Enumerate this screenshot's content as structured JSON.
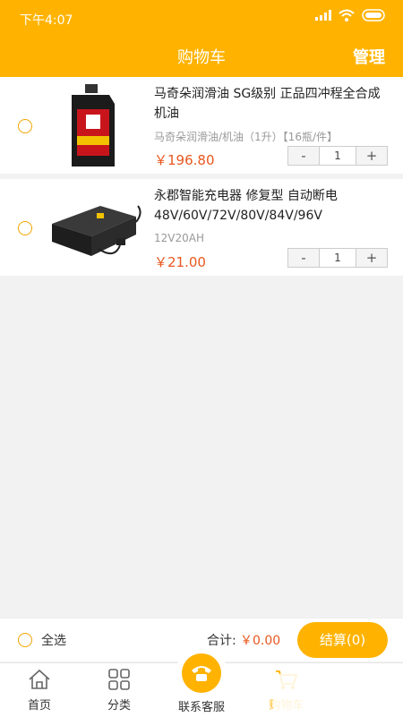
{
  "status": {
    "time": "下午4:07"
  },
  "header": {
    "title": "购物车",
    "manage": "管理"
  },
  "items": [
    {
      "name": "马奇朵润滑油 SG级别 正品四冲程全合成机油",
      "spec": "马奇朵润滑油/机油（1升）【16瓶/件】",
      "price": "￥196.80",
      "qty": "1"
    },
    {
      "name": "永郡智能充电器 修复型 自动断电48V/60V/72V/80V/84V/96V",
      "spec": "12V20AH",
      "price": "￥21.00",
      "qty": "1"
    }
  ],
  "checkout": {
    "select_all": "全选",
    "total_label": "合计:",
    "total_value": "￥0.00",
    "pay": "结算(0)"
  },
  "tabbar": {
    "home": "首页",
    "category": "分类",
    "service": "联系客服",
    "cart": "购物车"
  },
  "colors": {
    "accent": "#ffb300",
    "price": "#e8571e"
  }
}
